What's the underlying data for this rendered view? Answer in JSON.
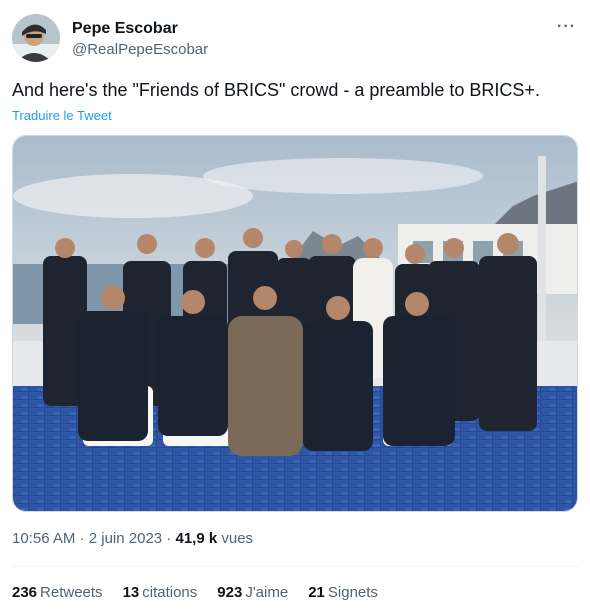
{
  "author": {
    "name": "Pepe Escobar",
    "handle": "@RealPepeEscobar"
  },
  "tweet": {
    "text": "And here's the \"Friends of BRICS\" crowd - a preamble to BRICS+.",
    "translate_label": "Traduire le Tweet"
  },
  "meta": {
    "time": "10:56 AM",
    "separator": "·",
    "date": "2 juin 2023",
    "separator2": "·",
    "views_count": "41,9 k",
    "views_label": "vues"
  },
  "stats": {
    "retweets_count": "236",
    "retweets_label": "Retweets",
    "quotes_count": "13",
    "quotes_label": "citations",
    "likes_count": "923",
    "likes_label": "J'aime",
    "bookmarks_count": "21",
    "bookmarks_label": "Signets"
  },
  "icons": {
    "more": "more-options-icon"
  },
  "colors": {
    "link": "#1d9bf0",
    "secondary_text": "#536471",
    "primary_text": "#0f1419"
  }
}
